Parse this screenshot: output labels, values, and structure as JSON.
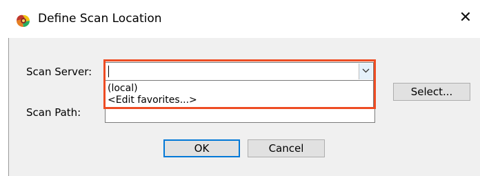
{
  "window": {
    "title": "Define Scan Location",
    "app_icon": "scanner-app-icon",
    "close_glyph": "✕"
  },
  "form": {
    "scan_server_label": "Scan Server:",
    "scan_server_value": "",
    "scan_path_label": "Scan Path:",
    "scan_path_value": "",
    "dropdown_options": [
      "(local)",
      "<Edit favorites...>"
    ]
  },
  "buttons": {
    "select_label": "Select...",
    "ok_label": "OK",
    "cancel_label": "Cancel"
  },
  "colors": {
    "highlight": "#ee4c23",
    "default_button_border": "#0078d7",
    "dialog_background": "#f0f0f0"
  }
}
